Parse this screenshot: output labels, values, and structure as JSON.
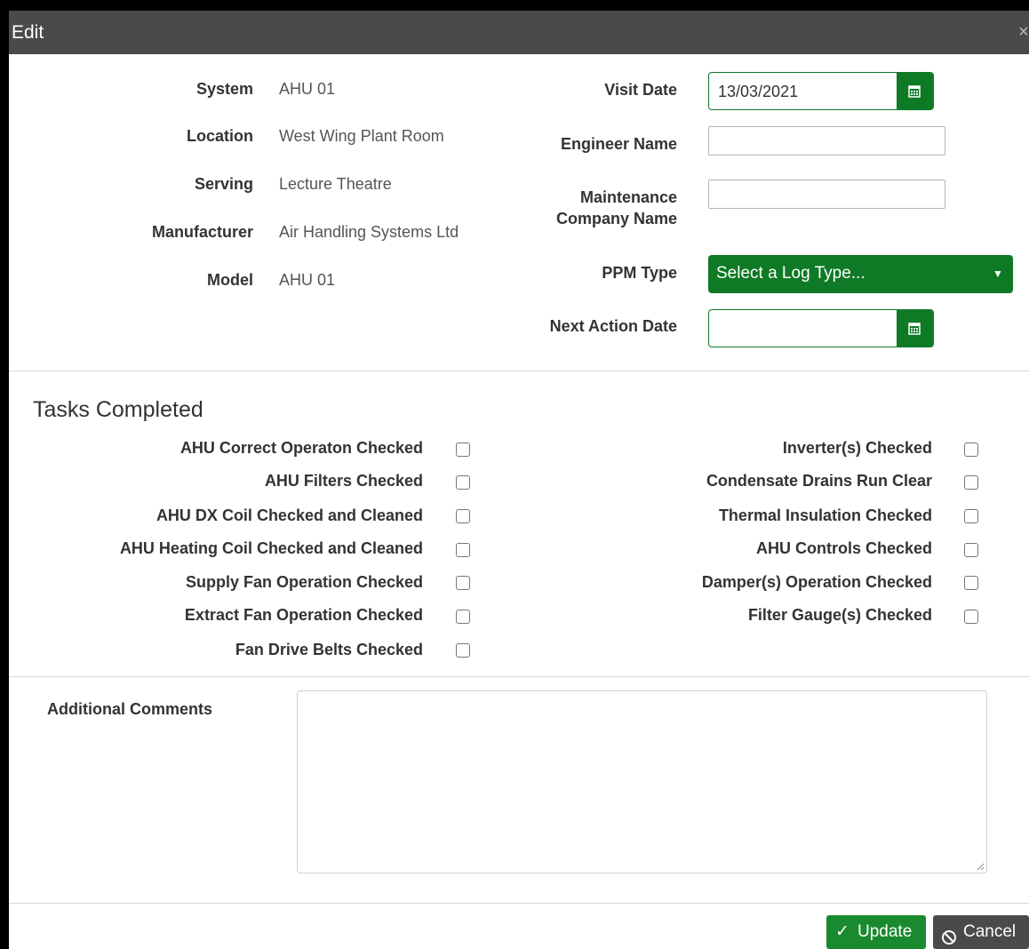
{
  "dialog": {
    "title": "Edit",
    "close_glyph": "×"
  },
  "info": {
    "system_label": "System",
    "system_value": "AHU 01",
    "location_label": "Location",
    "location_value": "West Wing Plant Room",
    "serving_label": "Serving",
    "serving_value": "Lecture Theatre",
    "manufacturer_label": "Manufacturer",
    "manufacturer_value": "Air Handling Systems Ltd",
    "model_label": "Model",
    "model_value": "AHU 01"
  },
  "form": {
    "visit_date_label": "Visit Date",
    "visit_date_value": "13/03/2021",
    "engineer_name_label": "Engineer Name",
    "engineer_name_value": "",
    "maintenance_label_line1": "Maintenance",
    "maintenance_label_line2": "Company Name",
    "maintenance_value": "",
    "ppm_type_label": "PPM Type",
    "ppm_type_selected": "Select a Log Type...",
    "next_action_label": "Next Action Date",
    "next_action_value": ""
  },
  "tasks": {
    "title": "Tasks Completed",
    "left": [
      {
        "label": "AHU Correct Operaton Checked",
        "checked": false
      },
      {
        "label": "AHU Filters Checked",
        "checked": false
      },
      {
        "label": "AHU DX Coil Checked and Cleaned",
        "checked": false
      },
      {
        "label": "AHU Heating Coil Checked and Cleaned",
        "checked": false
      },
      {
        "label": "Supply Fan Operation Checked",
        "checked": false
      },
      {
        "label": "Extract Fan Operation Checked",
        "checked": false
      },
      {
        "label": "Fan Drive Belts Checked",
        "checked": false
      }
    ],
    "right": [
      {
        "label": "Inverter(s) Checked",
        "checked": false
      },
      {
        "label": "Condensate Drains Run Clear",
        "checked": false
      },
      {
        "label": "Thermal Insulation Checked",
        "checked": false
      },
      {
        "label": "AHU Controls Checked",
        "checked": false
      },
      {
        "label": "Damper(s) Operation Checked",
        "checked": false
      },
      {
        "label": "Filter Gauge(s) Checked",
        "checked": false
      }
    ]
  },
  "comments": {
    "label": "Additional Comments",
    "value": ""
  },
  "buttons": {
    "update_label": "Update",
    "cancel_label": "Cancel"
  },
  "colors": {
    "accent_green": "#0f7a26",
    "titlebar": "#4a4a4a"
  }
}
